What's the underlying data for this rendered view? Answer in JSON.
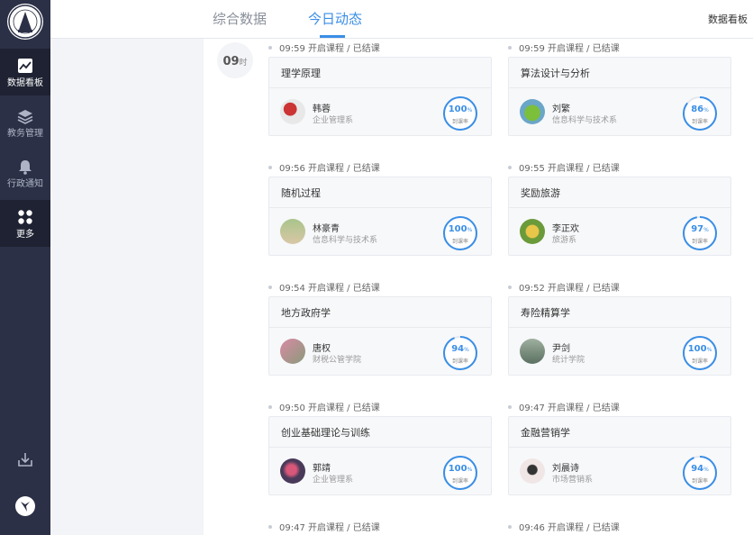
{
  "sidebar": {
    "items": [
      {
        "label": "数据看板",
        "icon": "chart-line-icon",
        "active": true
      },
      {
        "label": "教务管理",
        "icon": "layers-icon",
        "active": false
      },
      {
        "label": "行政通知",
        "icon": "bell-icon",
        "active": false
      },
      {
        "label": "更多",
        "icon": "grid-icon",
        "active": true
      }
    ],
    "bottom_icons": [
      "download-icon",
      "user-avatar-icon"
    ]
  },
  "header": {
    "tabs": [
      {
        "label": "综合数据",
        "active": false
      },
      {
        "label": "今日动态",
        "active": true
      }
    ],
    "right_text": "数据看板"
  },
  "timeline": {
    "hour": "09",
    "hour_unit": "时",
    "rows": [
      {
        "left": {
          "time": "09:59 开启课程 / 已结课",
          "course": "理学原理",
          "teacher": "韩蓉",
          "dept": "企业管理系",
          "rate": 100
        },
        "right": {
          "time": "09:59 开启课程 / 已结课",
          "course": "算法设计与分析",
          "teacher": "刘繁",
          "dept": "信息科学与技术系",
          "rate": 86
        }
      },
      {
        "left": {
          "time": "09:56 开启课程 / 已结课",
          "course": "随机过程",
          "teacher": "林豪青",
          "dept": "信息科学与技术系",
          "rate": 100
        },
        "right": {
          "time": "09:55 开启课程 / 已结课",
          "course": "奖励旅游",
          "teacher": "李正欢",
          "dept": "旅游系",
          "rate": 97
        }
      },
      {
        "left": {
          "time": "09:54 开启课程 / 已结课",
          "course": "地方政府学",
          "teacher": "唐权",
          "dept": "财税公管学院",
          "rate": 94
        },
        "right": {
          "time": "09:52 开启课程 / 已结课",
          "course": "寿险精算学",
          "teacher": "尹剑",
          "dept": "统计学院",
          "rate": 100
        }
      },
      {
        "left": {
          "time": "09:50 开启课程 / 已结课",
          "course": "创业基础理论与训练",
          "teacher": "郭靖",
          "dept": "企业管理系",
          "rate": 100
        },
        "right": {
          "time": "09:47 开启课程 / 已结课",
          "course": "金融营销学",
          "teacher": "刘晨诗",
          "dept": "市场营销系",
          "rate": 94
        }
      },
      {
        "left": {
          "time": "09:47 开启课程 / 已结课"
        },
        "right": {
          "time": "09:46 开启课程 / 已结课"
        }
      }
    ],
    "rate_unit": "%",
    "rate_label": "到课率"
  },
  "colors": {
    "accent": "#3a8ee6",
    "sidebar": "#2b3046",
    "sidebar_active": "#1e2232"
  }
}
